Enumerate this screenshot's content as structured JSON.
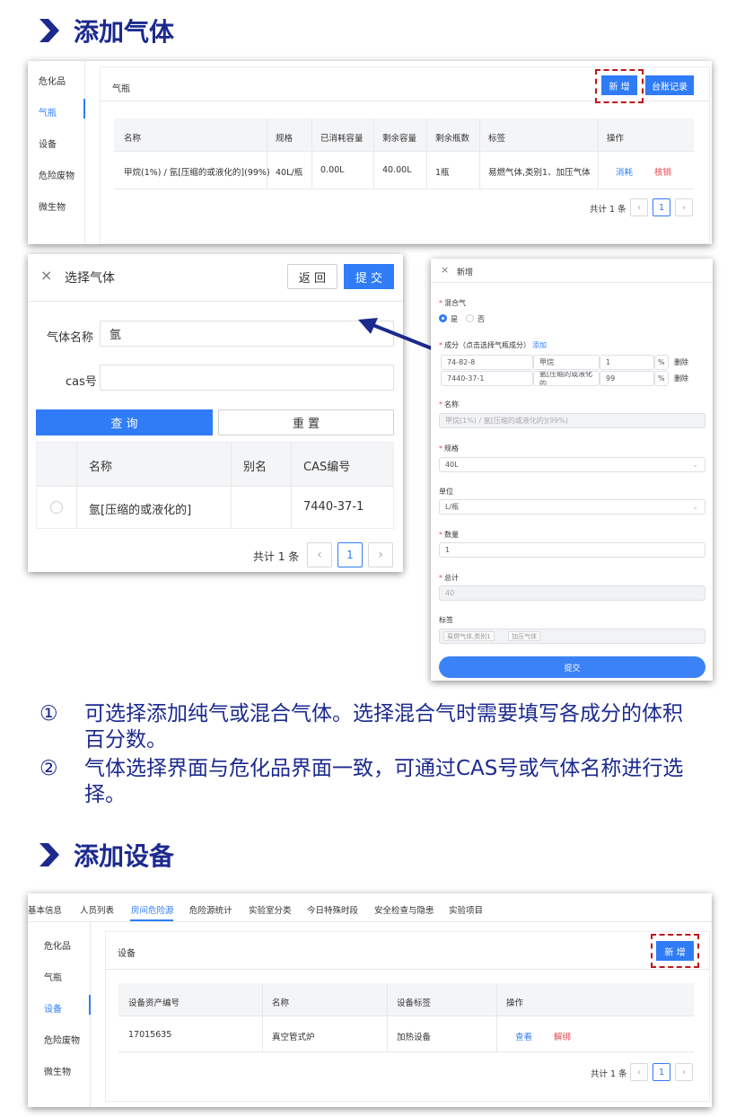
{
  "section1": {
    "title": "添加气体"
  },
  "gas_panel": {
    "sidebar": [
      "危化品",
      "气瓶",
      "设备",
      "危险废物",
      "微生物"
    ],
    "header": "气瓶",
    "btn_new": "新 增",
    "btn_ledger": "台账记录",
    "columns": [
      "名称",
      "规格",
      "已消耗容量",
      "剩余容量",
      "剩余瓶数",
      "标签",
      "操作"
    ],
    "row": [
      "甲烷(1%) / 氩[压缩的或液化的](99%)",
      "40L/瓶",
      "0.00L",
      "40.00L",
      "1瓶",
      "易燃气体,类别1、加压气体"
    ],
    "action_consume": "消耗",
    "action_cancel": "核销",
    "total": "共计 1 条",
    "page": "1"
  },
  "select_gas": {
    "close": "×",
    "title": "选择气体",
    "btn_back": "返 回",
    "btn_submit": "提 交",
    "label_name": "气体名称",
    "value_name": "氩",
    "label_cas": "cas号",
    "value_cas": "",
    "btn_query": "查 询",
    "btn_reset": "重 置",
    "columns": [
      "名称",
      "别名",
      "CAS编号"
    ],
    "row": [
      "氩[压缩的或液化的]",
      "",
      "7440-37-1"
    ],
    "total": "共计 1 条",
    "page": "1"
  },
  "new_form": {
    "close": "×",
    "title": "新增",
    "mix_label": "混合气",
    "opt_yes": "是",
    "opt_no": "否",
    "comp_label": "成分（点击选择气瓶成分）",
    "comp_add": "添加",
    "components": [
      {
        "cas": "74-82-8",
        "name": "甲烷",
        "pct": "1",
        "unit": "%",
        "del": "删除"
      },
      {
        "cas": "7440-37-1",
        "name": "氩[压缩的或液化的",
        "pct": "99",
        "unit": "%",
        "del": "删除"
      }
    ],
    "name_label": "名称",
    "name_value": "甲烷(1%) / 氩[压缩的或液化的](99%)",
    "spec_label": "规格",
    "spec_value": "40L",
    "unit_label": "单位",
    "unit_value": "L/瓶",
    "qty_label": "数量",
    "qty_value": "1",
    "total_label": "总计",
    "total_value": "40",
    "tag_label": "标签",
    "tags": [
      "易燃气体,类别1",
      "加压气体"
    ],
    "btn_submit": "提交"
  },
  "notes": [
    {
      "num": "①",
      "text": "可选择添加纯气或混合气体。选择混合气时需要填写各成分的体积百分数。"
    },
    {
      "num": "②",
      "text": "气体选择界面与危化品界面一致，可通过CAS号或气体名称进行选择。"
    }
  ],
  "section2": {
    "title": "添加设备"
  },
  "equip_panel": {
    "tabs": [
      "基本信息",
      "人员列表",
      "房间危险源",
      "危险源统计",
      "实验室分类",
      "今日特殊时段",
      "安全检查与隐患",
      "实验项目"
    ],
    "sidebar": [
      "危化品",
      "气瓶",
      "设备",
      "危险废物",
      "微生物"
    ],
    "header": "设备",
    "btn_new": "新 增",
    "columns": [
      "设备资产编号",
      "名称",
      "设备标签",
      "操作"
    ],
    "row": [
      "17015635",
      "真空管式炉",
      "加热设备"
    ],
    "action_view": "查看",
    "action_unbind": "解绑",
    "total": "共计 1 条",
    "page": "1"
  },
  "colors": {
    "primary": "#2f7cf6",
    "title": "#1c2a8e",
    "danger": "#e6454a",
    "dash": "#c0161b"
  }
}
